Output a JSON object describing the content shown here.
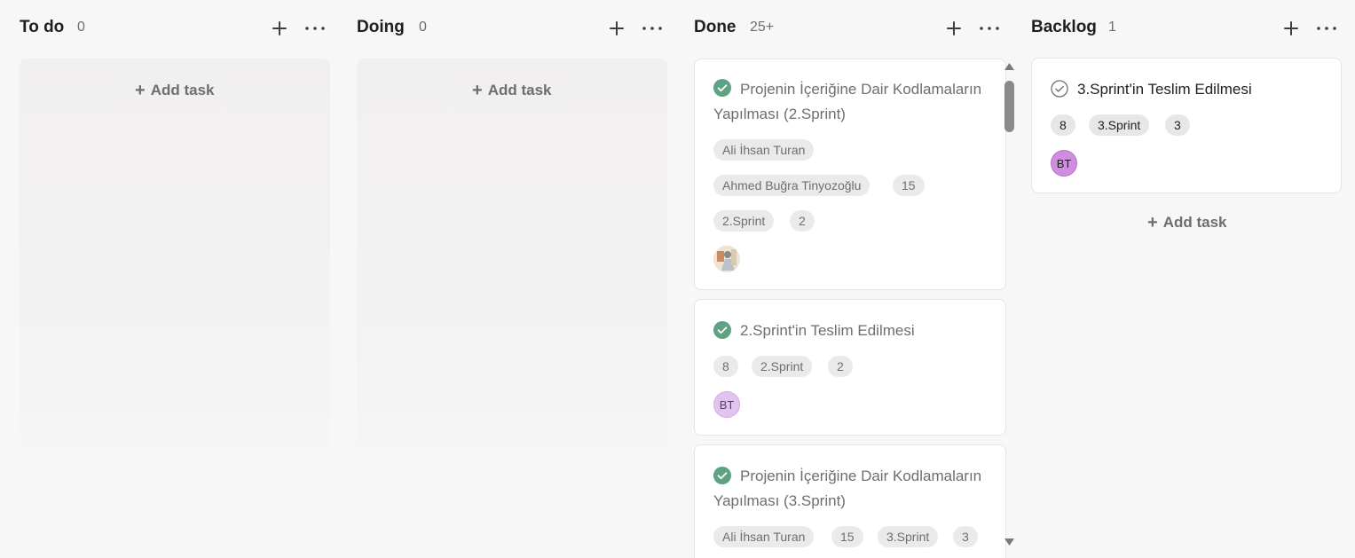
{
  "columns": [
    {
      "title": "To do",
      "count": "0",
      "add_task": "Add task"
    },
    {
      "title": "Doing",
      "count": "0",
      "add_task": "Add task"
    },
    {
      "title": "Done",
      "count": "25+",
      "cards": [
        {
          "title_line1": "Projenin İçeriğine Dair Kodlamaların",
          "title_line2": "Yapılması (2.Sprint)",
          "tags": [
            "Ali İhsan Turan",
            "Ahmed Buğra Tinyozoğlu",
            "15",
            "2.Sprint",
            "2"
          ]
        },
        {
          "title": "2.Sprint'in Teslim Edilmesi",
          "tags": [
            "8",
            "2.Sprint",
            "2"
          ],
          "avatar": "BT"
        },
        {
          "title_line1": "Projenin İçeriğine Dair Kodlamaların",
          "title_line2": "Yapılması (3.Sprint)",
          "tags": [
            "Ali İhsan Turan",
            "15",
            "3.Sprint",
            "3"
          ]
        }
      ]
    },
    {
      "title": "Backlog",
      "count": "1",
      "add_task": "Add task",
      "cards": [
        {
          "title": "3.Sprint'in Teslim Edilmesi",
          "tags": [
            "8",
            "3.Sprint",
            "3"
          ],
          "avatar": "BT"
        }
      ]
    }
  ],
  "colors": {
    "background": "#f7f7f7",
    "done_check": "#5da283",
    "avatar_bt_light": "#e3c3f0",
    "avatar_bt": "#d08de0",
    "tag_bg": "#ebeaea"
  },
  "icons": {
    "add": "plus-icon",
    "more": "more-horizontal-icon",
    "check": "check-circle-icon"
  }
}
